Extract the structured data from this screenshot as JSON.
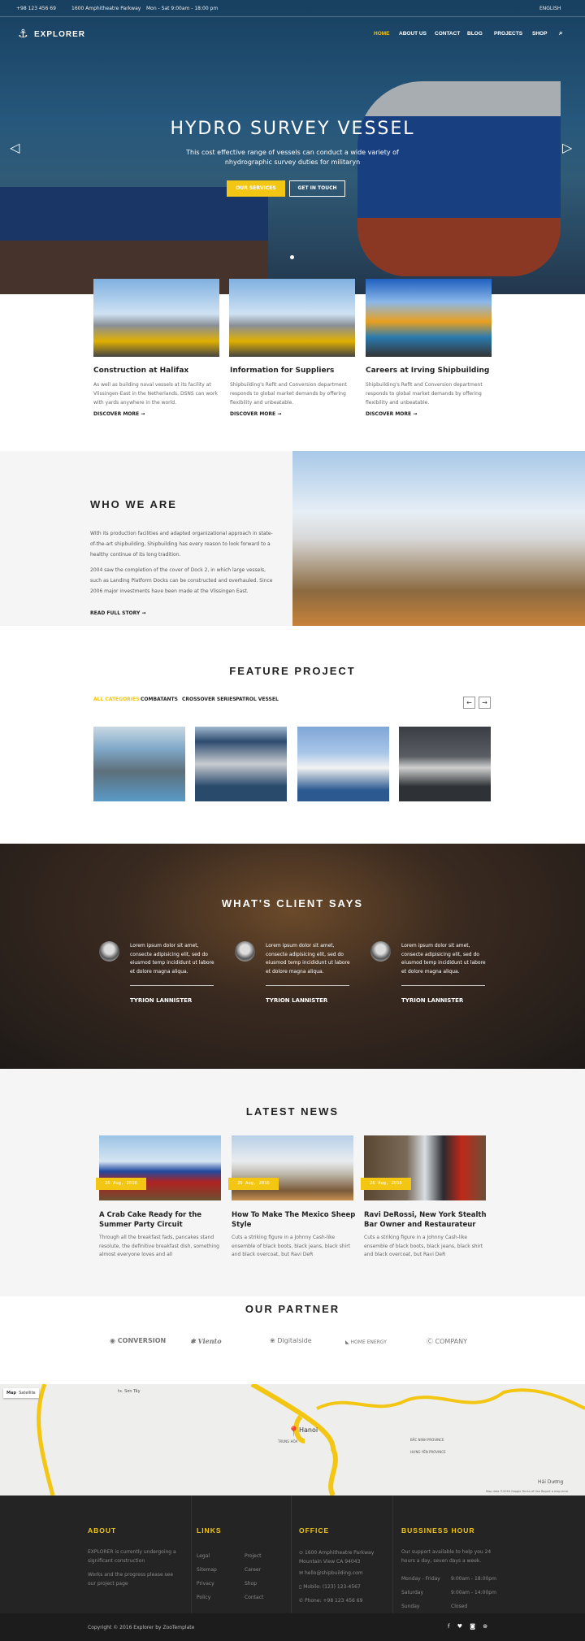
{
  "topbar": {
    "phone": "+98 123 456 69",
    "address": "1600 Amphitheatre Parkway",
    "hours": "Mon - Sat 9:00am - 18:00 pm",
    "language": "ENGLISH"
  },
  "nav": {
    "logo": "EXPLORER",
    "items": [
      "HOME",
      "ABOUT US",
      "CONTACT",
      "BLOG",
      "PROJECTS",
      "SHOP"
    ],
    "active": "HOME"
  },
  "hero": {
    "title": "HYDRO SURVEY VESSEL",
    "subtitle": "This cost effective range of vessels can conduct a wide variety of nhydrographic survey duties for militaryn",
    "btn_primary": "OUR SERVICES",
    "btn_secondary": "GET IN TOUCH"
  },
  "services": [
    {
      "title": "Construction at Halifax",
      "text": "As well as building naval vessels at its facility at Vlissingen-East in the Netherlands, DSNS can work with yards anywhere in the world.",
      "link": "DISCOVER MORE"
    },
    {
      "title": "Information for Suppliers",
      "text": "Shipbuilding's Refit and Conversion department responds to global market demands by offering flexibility and unbeatable.",
      "link": "DISCOVER MORE"
    },
    {
      "title": "Careers at Irving Shipbuilding",
      "text": "Shipbuilding's Refit and Conversion department responds to global market demands by offering flexibility and unbeatable.",
      "link": "DISCOVER MORE"
    }
  ],
  "about": {
    "title": "WHO WE ARE",
    "p1": "With its production facilities and adapted organizational approach in state-of-the-art shipbuilding, Shipbuilding has every reason to look forward to a healthy continue of its long tradition.",
    "p2": "2004 saw the completion of the cover of Dock 2, in which large vessels, such as Landing Platform Docks can be constructed and overhauled. Since 2006 major investments have been made at the Vlissingen East.",
    "link": "READ FULL STORY"
  },
  "projects": {
    "title": "FEATURE PROJECT",
    "tabs": [
      "ALL CATEGORIES",
      "COMBATANTS",
      "CROSSOVER SERIES",
      "PATROL VESSEL"
    ],
    "active": "ALL CATEGORIES",
    "prev": "←",
    "next": "→"
  },
  "testimonials": {
    "title": "WHAT'S CLIENT SAYS",
    "items": [
      {
        "text": "Lorem ipsum dolor sit amet, consecte adipisicing elit, sed do eiusmod temp incididunt ut labore et dolore magna aliqua.",
        "name": "TYRION LANNISTER"
      },
      {
        "text": "Lorem ipsum dolor sit amet, consecte adipisicing elit, sed do eiusmod temp incididunt ut labore et dolore magna aliqua.",
        "name": "TYRION LANNISTER"
      },
      {
        "text": "Lorem ipsum dolor sit amet, consecte adipisicing elit, sed do eiusmod temp incididunt ut labore et dolore magna aliqua.",
        "name": "TYRION LANNISTER"
      }
    ]
  },
  "news": {
    "title": "LATEST NEWS",
    "items": [
      {
        "date": "26 Aug, 2016",
        "title": "A Crab Cake Ready for the Summer Party Circuit",
        "text": "Through all the breakfast fads, pancakes stand resolute, the definitive breakfast dish, something almost everyone loves and all"
      },
      {
        "date": "26 Aug, 2016",
        "title": "How To Make The Mexico Sheep Style",
        "text": "Cuts a striking figure in a Johnny Cash-like ensemble of black boots, black jeans, black shirt and black overcoat, but Ravi DeR"
      },
      {
        "date": "26 Aug, 2016",
        "title": "Ravi DeRossi, New York Stealth Bar Owner and Restaurateur",
        "text": "Cuts a striking figure in a Johnny Cash-like ensemble of black boots, black jeans, black shirt and black overcoat, but Ravi DeR"
      }
    ]
  },
  "partners": {
    "title": "OUR PARTNER",
    "logos": [
      "CONVERSION",
      "Viento",
      "Digitalside",
      "HOME ENERGY",
      "COMPANY"
    ]
  },
  "map": {
    "btn_map": "Map",
    "btn_satellite": "Satellite",
    "city": "Hanoi",
    "labels": [
      "tx. Sơn Tây",
      "TRUNG HÒA",
      "BẮC NINH PROVINCE",
      "HƯNG YÊN PROVINCE",
      "Hải Dương"
    ],
    "attribution": "Map data ©2016 Google  Terms of Use  Report a map error"
  },
  "footer": {
    "about": {
      "title": "ABOUT",
      "p1": "EXPLORER is currently undergoing a significant construction",
      "p2": "Works and the progress please see our project page"
    },
    "links": {
      "title": "LINKS",
      "col1": [
        "Legal",
        "Sitemap",
        "Privacy",
        "Policy"
      ],
      "col2": [
        "Project",
        "Career",
        "Shop",
        "Contact"
      ]
    },
    "office": {
      "title": "OFFICE",
      "address": "1600 Amphitheatre Parkway Mountain View CA 94043",
      "email": "hello@shipbuilding.com",
      "mobile": "Mobile: (123) 123-4567",
      "phone": "Phone: +98 123 456 69"
    },
    "hours": {
      "title": "BUSSINESS HOUR",
      "text": "Our support available to help you 24 hours a day, seven days a week.",
      "rows": [
        [
          "Monday - Friday",
          "9:00am - 18:00pm"
        ],
        [
          "Saturday",
          "9:00am - 14:00pm"
        ],
        [
          "Sunday",
          "Closed"
        ]
      ]
    },
    "copyright": "Copyright © 2016 Explorer by ZooTemplate"
  },
  "colors": {
    "accent": "#f3c614",
    "dark": "#222222"
  }
}
